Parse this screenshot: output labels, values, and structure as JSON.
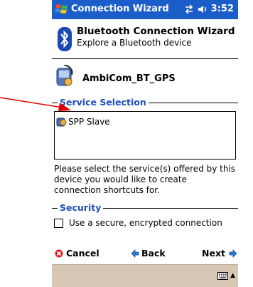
{
  "window": {
    "title": "Connection Wizard",
    "time": "3:52"
  },
  "wizard": {
    "title": "Bluetooth Connection Wizard",
    "subtitle": "Explore a Bluetooth device"
  },
  "device": {
    "name": "AmbiCom_BT_GPS"
  },
  "service_selection": {
    "caption": "Service Selection",
    "items": [
      {
        "label": "SPP Slave"
      }
    ],
    "help_text": "Please select the service(s) offered by this device you would like to create connection shortcuts for."
  },
  "security": {
    "caption": "Security",
    "checkbox_label": "Use a secure, encrypted connection",
    "checked": false
  },
  "nav": {
    "cancel": "Cancel",
    "back": "Back",
    "next": "Next"
  },
  "colors": {
    "titlebar": "#1c5ec9",
    "caption": "#1c4fbd",
    "bottombar": "#d8c7b5"
  }
}
